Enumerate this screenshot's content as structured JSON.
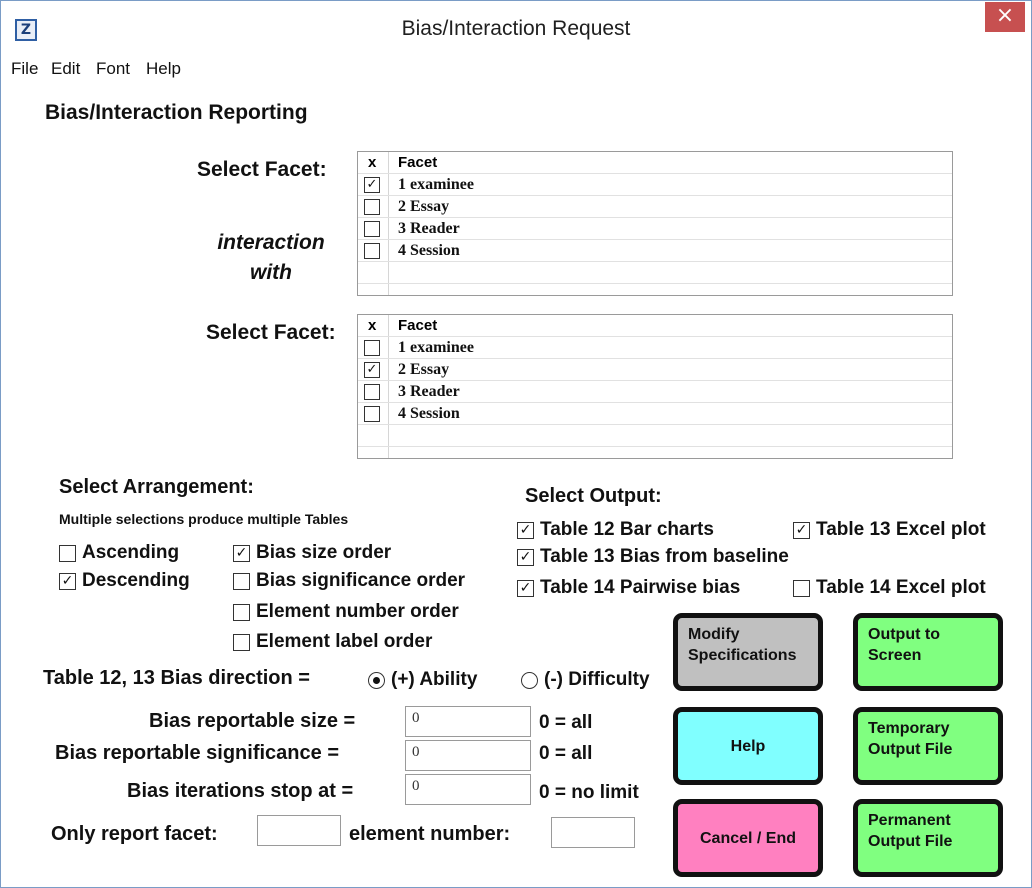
{
  "window": {
    "title": "Bias/Interaction Request",
    "icon_glyph": "Z",
    "close_glyph": "×",
    "accent": "#c75050"
  },
  "menu": [
    "File",
    "Edit",
    "Font",
    "Help"
  ],
  "section_title": "Bias/Interaction Reporting",
  "facet1": {
    "label": "Select Facet:",
    "col_x": "x",
    "col_facet": "Facet",
    "rows": [
      {
        "checked": true,
        "text": "1 examinee"
      },
      {
        "checked": false,
        "text": "2 Essay"
      },
      {
        "checked": false,
        "text": "3 Reader"
      },
      {
        "checked": false,
        "text": "4 Session"
      }
    ]
  },
  "interaction": {
    "line1": "interaction",
    "line2": "with"
  },
  "facet2": {
    "label": "Select Facet:",
    "col_x": "x",
    "col_facet": "Facet",
    "rows": [
      {
        "checked": false,
        "text": "1 examinee"
      },
      {
        "checked": true,
        "text": "2 Essay"
      },
      {
        "checked": false,
        "text": "3 Reader"
      },
      {
        "checked": false,
        "text": "4 Session"
      }
    ]
  },
  "arrangement": {
    "title": "Select Arrangement:",
    "note": "Multiple selections produce multiple Tables",
    "ascending": {
      "label": "Ascending",
      "checked": false
    },
    "descending": {
      "label": "Descending",
      "checked": true
    },
    "bias_size": {
      "label": "Bias size order",
      "checked": true
    },
    "bias_significance": {
      "label": "Bias significance order",
      "checked": false
    },
    "element_number": {
      "label": "Element number order",
      "checked": false
    },
    "element_label": {
      "label": "Element label order",
      "checked": false
    }
  },
  "output": {
    "title": "Select Output:",
    "t12_bar": {
      "label": "Table 12 Bar charts",
      "checked": true
    },
    "t13_excel": {
      "label": "Table 13 Excel plot",
      "checked": true
    },
    "t13_baseline": {
      "label": "Table 13 Bias from baseline",
      "checked": true
    },
    "t14_pairwise": {
      "label": "Table 14 Pairwise bias",
      "checked": true
    },
    "t14_excel": {
      "label": "Table 14 Excel plot",
      "checked": false
    }
  },
  "direction": {
    "label": "Table 12, 13 Bias direction =",
    "ability": {
      "label": "(+) Ability",
      "selected": true
    },
    "difficulty": {
      "label": "(-) Difficulty",
      "selected": false
    }
  },
  "fields": {
    "size": {
      "label": "Bias reportable size =",
      "value": "0",
      "hint": "0 = all"
    },
    "significance": {
      "label": "Bias reportable significance =",
      "value": "0",
      "hint": "0 = all"
    },
    "iterations": {
      "label": "Bias iterations stop at =",
      "value": "0",
      "hint": "0 = no limit"
    },
    "only_facet": {
      "label": "Only report facet:",
      "value": ""
    },
    "element_number": {
      "label": "element number:",
      "value": ""
    }
  },
  "buttons": {
    "modify": {
      "label": "Modify Specifications",
      "color": "#c0c0c0"
    },
    "screen": {
      "label": "Output to Screen",
      "color": "#80ff80"
    },
    "help": {
      "label": "Help",
      "color": "#80ffff"
    },
    "temp": {
      "label": "Temporary Output File",
      "color": "#80ff80"
    },
    "cancel": {
      "label": "Cancel / End",
      "color": "#ff80c0"
    },
    "perm": {
      "label": "Permanent Output File",
      "color": "#80ff80"
    }
  }
}
